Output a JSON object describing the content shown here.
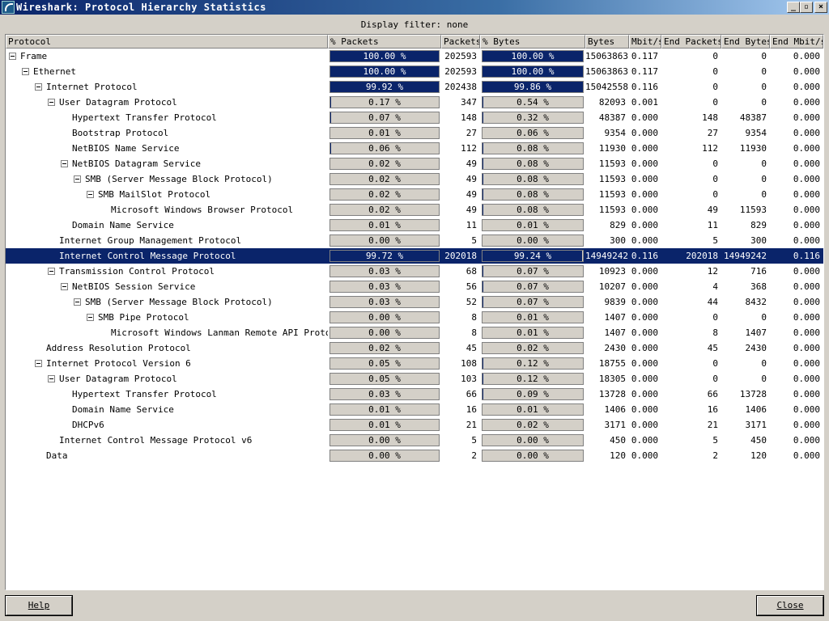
{
  "window": {
    "title": "Wireshark: Protocol Hierarchy Statistics"
  },
  "icons": {
    "app": "wireshark-fin-icon",
    "minimize": "minimize-icon",
    "maximize": "maximize-icon",
    "close": "close-icon",
    "expander": "collapse-minus-icon"
  },
  "filter_text": "Display filter: none",
  "columns": [
    "Protocol",
    "% Packets",
    "Packets",
    "% Bytes",
    "Bytes",
    "Mbit/s",
    "End Packets",
    "End Bytes",
    "End Mbit/s"
  ],
  "rows": [
    {
      "name": "Frame",
      "depth": 0,
      "expandable": true,
      "pct_packets": "100.00 %",
      "pct_packets_val": 100,
      "packets": "202593",
      "pct_bytes": "100.00 %",
      "pct_bytes_val": 100,
      "bytes": "15063863",
      "mbit": "0.117",
      "end_packets": "0",
      "end_bytes": "0",
      "end_mbit": "0.000"
    },
    {
      "name": "Ethernet",
      "depth": 1,
      "expandable": true,
      "pct_packets": "100.00 %",
      "pct_packets_val": 100,
      "packets": "202593",
      "pct_bytes": "100.00 %",
      "pct_bytes_val": 100,
      "bytes": "15063863",
      "mbit": "0.117",
      "end_packets": "0",
      "end_bytes": "0",
      "end_mbit": "0.000"
    },
    {
      "name": "Internet Protocol",
      "depth": 2,
      "expandable": true,
      "pct_packets": "99.92 %",
      "pct_packets_val": 99.92,
      "packets": "202438",
      "pct_bytes": "99.86 %",
      "pct_bytes_val": 99.86,
      "bytes": "15042558",
      "mbit": "0.116",
      "end_packets": "0",
      "end_bytes": "0",
      "end_mbit": "0.000"
    },
    {
      "name": "User Datagram Protocol",
      "depth": 3,
      "expandable": true,
      "pct_packets": "0.17 %",
      "pct_packets_val": 0.17,
      "packets": "347",
      "pct_bytes": "0.54 %",
      "pct_bytes_val": 0.54,
      "bytes": "82093",
      "mbit": "0.001",
      "end_packets": "0",
      "end_bytes": "0",
      "end_mbit": "0.000"
    },
    {
      "name": "Hypertext Transfer Protocol",
      "depth": 4,
      "expandable": false,
      "pct_packets": "0.07 %",
      "pct_packets_val": 0.07,
      "packets": "148",
      "pct_bytes": "0.32 %",
      "pct_bytes_val": 0.32,
      "bytes": "48387",
      "mbit": "0.000",
      "end_packets": "148",
      "end_bytes": "48387",
      "end_mbit": "0.000"
    },
    {
      "name": "Bootstrap Protocol",
      "depth": 4,
      "expandable": false,
      "pct_packets": "0.01 %",
      "pct_packets_val": 0.01,
      "packets": "27",
      "pct_bytes": "0.06 %",
      "pct_bytes_val": 0.06,
      "bytes": "9354",
      "mbit": "0.000",
      "end_packets": "27",
      "end_bytes": "9354",
      "end_mbit": "0.000"
    },
    {
      "name": "NetBIOS Name Service",
      "depth": 4,
      "expandable": false,
      "pct_packets": "0.06 %",
      "pct_packets_val": 0.06,
      "packets": "112",
      "pct_bytes": "0.08 %",
      "pct_bytes_val": 0.08,
      "bytes": "11930",
      "mbit": "0.000",
      "end_packets": "112",
      "end_bytes": "11930",
      "end_mbit": "0.000"
    },
    {
      "name": "NetBIOS Datagram Service",
      "depth": 4,
      "expandable": true,
      "pct_packets": "0.02 %",
      "pct_packets_val": 0.02,
      "packets": "49",
      "pct_bytes": "0.08 %",
      "pct_bytes_val": 0.08,
      "bytes": "11593",
      "mbit": "0.000",
      "end_packets": "0",
      "end_bytes": "0",
      "end_mbit": "0.000"
    },
    {
      "name": "SMB (Server Message Block Protocol)",
      "depth": 5,
      "expandable": true,
      "pct_packets": "0.02 %",
      "pct_packets_val": 0.02,
      "packets": "49",
      "pct_bytes": "0.08 %",
      "pct_bytes_val": 0.08,
      "bytes": "11593",
      "mbit": "0.000",
      "end_packets": "0",
      "end_bytes": "0",
      "end_mbit": "0.000"
    },
    {
      "name": "SMB MailSlot Protocol",
      "depth": 6,
      "expandable": true,
      "pct_packets": "0.02 %",
      "pct_packets_val": 0.02,
      "packets": "49",
      "pct_bytes": "0.08 %",
      "pct_bytes_val": 0.08,
      "bytes": "11593",
      "mbit": "0.000",
      "end_packets": "0",
      "end_bytes": "0",
      "end_mbit": "0.000"
    },
    {
      "name": "Microsoft Windows Browser Protocol",
      "depth": 7,
      "expandable": false,
      "pct_packets": "0.02 %",
      "pct_packets_val": 0.02,
      "packets": "49",
      "pct_bytes": "0.08 %",
      "pct_bytes_val": 0.08,
      "bytes": "11593",
      "mbit": "0.000",
      "end_packets": "49",
      "end_bytes": "11593",
      "end_mbit": "0.000"
    },
    {
      "name": "Domain Name Service",
      "depth": 4,
      "expandable": false,
      "pct_packets": "0.01 %",
      "pct_packets_val": 0.01,
      "packets": "11",
      "pct_bytes": "0.01 %",
      "pct_bytes_val": 0.01,
      "bytes": "829",
      "mbit": "0.000",
      "end_packets": "11",
      "end_bytes": "829",
      "end_mbit": "0.000"
    },
    {
      "name": "Internet Group Management Protocol",
      "depth": 3,
      "expandable": false,
      "pct_packets": "0.00 %",
      "pct_packets_val": 0,
      "packets": "5",
      "pct_bytes": "0.00 %",
      "pct_bytes_val": 0,
      "bytes": "300",
      "mbit": "0.000",
      "end_packets": "5",
      "end_bytes": "300",
      "end_mbit": "0.000"
    },
    {
      "name": "Internet Control Message Protocol",
      "depth": 3,
      "expandable": false,
      "selected": true,
      "pct_packets": "99.72 %",
      "pct_packets_val": 99.72,
      "packets": "202018",
      "pct_bytes": "99.24 %",
      "pct_bytes_val": 99.24,
      "bytes": "14949242",
      "mbit": "0.116",
      "end_packets": "202018",
      "end_bytes": "14949242",
      "end_mbit": "0.116"
    },
    {
      "name": "Transmission Control Protocol",
      "depth": 3,
      "expandable": true,
      "pct_packets": "0.03 %",
      "pct_packets_val": 0.03,
      "packets": "68",
      "pct_bytes": "0.07 %",
      "pct_bytes_val": 0.07,
      "bytes": "10923",
      "mbit": "0.000",
      "end_packets": "12",
      "end_bytes": "716",
      "end_mbit": "0.000"
    },
    {
      "name": "NetBIOS Session Service",
      "depth": 4,
      "expandable": true,
      "pct_packets": "0.03 %",
      "pct_packets_val": 0.03,
      "packets": "56",
      "pct_bytes": "0.07 %",
      "pct_bytes_val": 0.07,
      "bytes": "10207",
      "mbit": "0.000",
      "end_packets": "4",
      "end_bytes": "368",
      "end_mbit": "0.000"
    },
    {
      "name": "SMB (Server Message Block Protocol)",
      "depth": 5,
      "expandable": true,
      "pct_packets": "0.03 %",
      "pct_packets_val": 0.03,
      "packets": "52",
      "pct_bytes": "0.07 %",
      "pct_bytes_val": 0.07,
      "bytes": "9839",
      "mbit": "0.000",
      "end_packets": "44",
      "end_bytes": "8432",
      "end_mbit": "0.000"
    },
    {
      "name": "SMB Pipe Protocol",
      "depth": 6,
      "expandable": true,
      "pct_packets": "0.00 %",
      "pct_packets_val": 0,
      "packets": "8",
      "pct_bytes": "0.01 %",
      "pct_bytes_val": 0.01,
      "bytes": "1407",
      "mbit": "0.000",
      "end_packets": "0",
      "end_bytes": "0",
      "end_mbit": "0.000"
    },
    {
      "name": "Microsoft Windows Lanman Remote API Protocol",
      "depth": 7,
      "expandable": false,
      "pct_packets": "0.00 %",
      "pct_packets_val": 0,
      "packets": "8",
      "pct_bytes": "0.01 %",
      "pct_bytes_val": 0.01,
      "bytes": "1407",
      "mbit": "0.000",
      "end_packets": "8",
      "end_bytes": "1407",
      "end_mbit": "0.000"
    },
    {
      "name": "Address Resolution Protocol",
      "depth": 2,
      "expandable": false,
      "pct_packets": "0.02 %",
      "pct_packets_val": 0.02,
      "packets": "45",
      "pct_bytes": "0.02 %",
      "pct_bytes_val": 0.02,
      "bytes": "2430",
      "mbit": "0.000",
      "end_packets": "45",
      "end_bytes": "2430",
      "end_mbit": "0.000"
    },
    {
      "name": "Internet Protocol Version 6",
      "depth": 2,
      "expandable": true,
      "pct_packets": "0.05 %",
      "pct_packets_val": 0.05,
      "packets": "108",
      "pct_bytes": "0.12 %",
      "pct_bytes_val": 0.12,
      "bytes": "18755",
      "mbit": "0.000",
      "end_packets": "0",
      "end_bytes": "0",
      "end_mbit": "0.000"
    },
    {
      "name": "User Datagram Protocol",
      "depth": 3,
      "expandable": true,
      "pct_packets": "0.05 %",
      "pct_packets_val": 0.05,
      "packets": "103",
      "pct_bytes": "0.12 %",
      "pct_bytes_val": 0.12,
      "bytes": "18305",
      "mbit": "0.000",
      "end_packets": "0",
      "end_bytes": "0",
      "end_mbit": "0.000"
    },
    {
      "name": "Hypertext Transfer Protocol",
      "depth": 4,
      "expandable": false,
      "pct_packets": "0.03 %",
      "pct_packets_val": 0.03,
      "packets": "66",
      "pct_bytes": "0.09 %",
      "pct_bytes_val": 0.09,
      "bytes": "13728",
      "mbit": "0.000",
      "end_packets": "66",
      "end_bytes": "13728",
      "end_mbit": "0.000"
    },
    {
      "name": "Domain Name Service",
      "depth": 4,
      "expandable": false,
      "pct_packets": "0.01 %",
      "pct_packets_val": 0.01,
      "packets": "16",
      "pct_bytes": "0.01 %",
      "pct_bytes_val": 0.01,
      "bytes": "1406",
      "mbit": "0.000",
      "end_packets": "16",
      "end_bytes": "1406",
      "end_mbit": "0.000"
    },
    {
      "name": "DHCPv6",
      "depth": 4,
      "expandable": false,
      "pct_packets": "0.01 %",
      "pct_packets_val": 0.01,
      "packets": "21",
      "pct_bytes": "0.02 %",
      "pct_bytes_val": 0.02,
      "bytes": "3171",
      "mbit": "0.000",
      "end_packets": "21",
      "end_bytes": "3171",
      "end_mbit": "0.000"
    },
    {
      "name": "Internet Control Message Protocol v6",
      "depth": 3,
      "expandable": false,
      "pct_packets": "0.00 %",
      "pct_packets_val": 0,
      "packets": "5",
      "pct_bytes": "0.00 %",
      "pct_bytes_val": 0,
      "bytes": "450",
      "mbit": "0.000",
      "end_packets": "5",
      "end_bytes": "450",
      "end_mbit": "0.000"
    },
    {
      "name": "Data",
      "depth": 2,
      "expandable": false,
      "pct_packets": "0.00 %",
      "pct_packets_val": 0,
      "packets": "2",
      "pct_bytes": "0.00 %",
      "pct_bytes_val": 0,
      "bytes": "120",
      "mbit": "0.000",
      "end_packets": "2",
      "end_bytes": "120",
      "end_mbit": "0.000"
    }
  ],
  "buttons": {
    "help": "Help",
    "close": "Close"
  }
}
